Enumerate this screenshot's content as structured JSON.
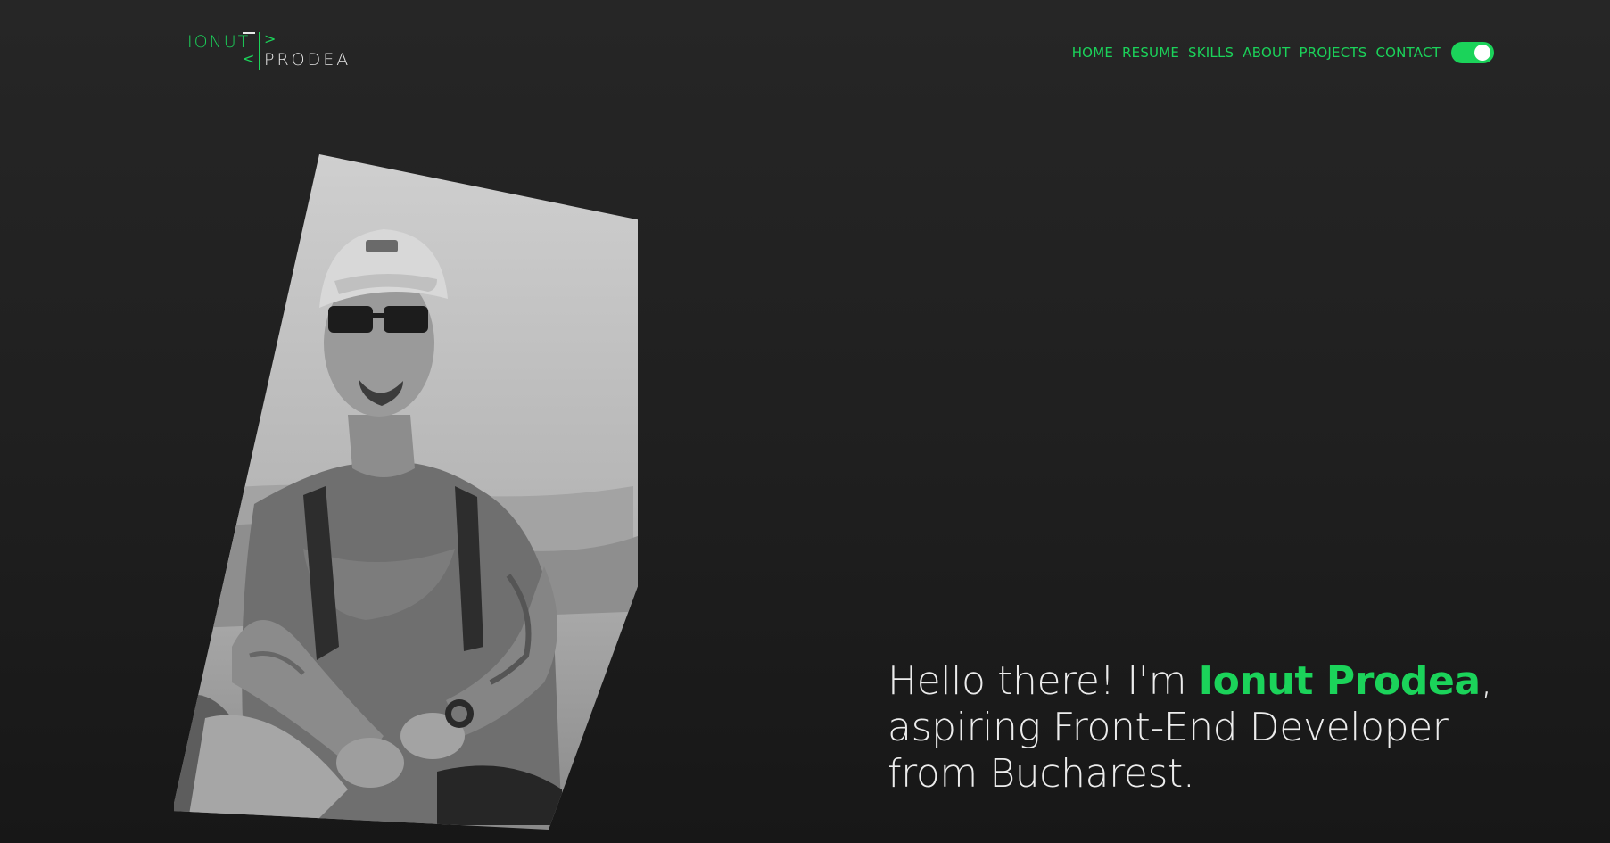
{
  "colors": {
    "accent": "#1bd35a",
    "text": "#ececec",
    "background": "#1f1f1f"
  },
  "logo": {
    "first_name": "IONUT",
    "last_name": "PRODEA",
    "bracket_open": ">",
    "bracket_close": "<"
  },
  "nav": {
    "items": [
      {
        "label": "HOME"
      },
      {
        "label": "RESUME"
      },
      {
        "label": "SKILLS"
      },
      {
        "label": "ABOUT"
      },
      {
        "label": "PROJECTS"
      },
      {
        "label": "CONTACT"
      }
    ],
    "theme_toggle_on": true
  },
  "hero": {
    "greeting": "Hello there! I'm ",
    "name": "Ionut Prodea",
    "comma": ",",
    "line2": "aspiring Front-End Developer",
    "line3": "from Bucharest."
  },
  "photo": {
    "subject": "portrait"
  }
}
